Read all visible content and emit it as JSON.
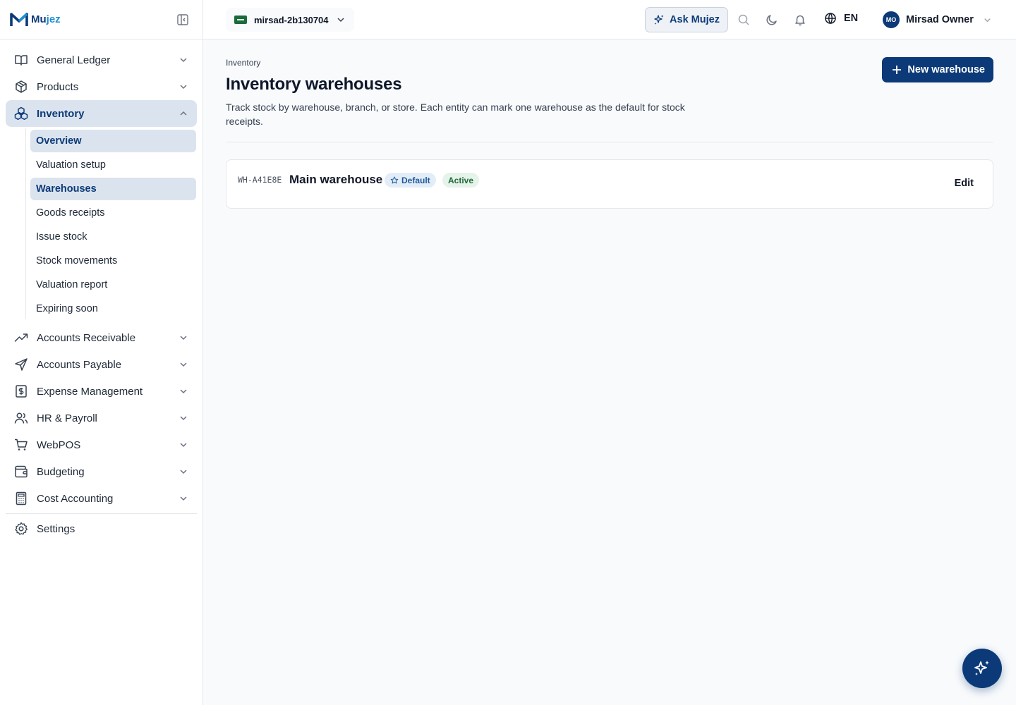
{
  "brand": {
    "name_part1": "Mu",
    "name_part2": "jez"
  },
  "topbar": {
    "org_name": "mirsad-2b130704",
    "ask_label": "Ask Mujez",
    "language": "EN",
    "user_initials": "MO",
    "user_name": "Mirsad Owner"
  },
  "sidebar": {
    "items": [
      {
        "label": "General Ledger",
        "icon": "book-open-icon"
      },
      {
        "label": "Products",
        "icon": "box-icon"
      },
      {
        "label": "Inventory",
        "icon": "boxes-icon",
        "expanded": true
      },
      {
        "label": "Accounts Receivable",
        "icon": "trending-up-icon"
      },
      {
        "label": "Accounts Payable",
        "icon": "send-icon"
      },
      {
        "label": "Expense Management",
        "icon": "receipt-dollar-icon"
      },
      {
        "label": "HR & Payroll",
        "icon": "users-icon"
      },
      {
        "label": "WebPOS",
        "icon": "shopping-cart-icon"
      },
      {
        "label": "Budgeting",
        "icon": "wallet-icon"
      },
      {
        "label": "Cost Accounting",
        "icon": "calculator-icon"
      }
    ],
    "inventory_sub": [
      "Overview",
      "Valuation setup",
      "Warehouses",
      "Goods receipts",
      "Issue stock",
      "Stock movements",
      "Valuation report",
      "Expiring soon"
    ],
    "settings_label": "Settings"
  },
  "page": {
    "breadcrumb": "Inventory",
    "title": "Inventory warehouses",
    "description": "Track stock by warehouse, branch, or store. Each entity can mark one warehouse as the default for stock receipts.",
    "new_button": "New warehouse"
  },
  "warehouses": [
    {
      "code": "WH-A41E8E",
      "name": "Main warehouse",
      "default_label": "Default",
      "status": "Active",
      "edit_label": "Edit"
    }
  ],
  "colors": {
    "primary": "#0c3a78",
    "accent": "#1d8fd1",
    "active_bg": "#dbe4ee"
  }
}
